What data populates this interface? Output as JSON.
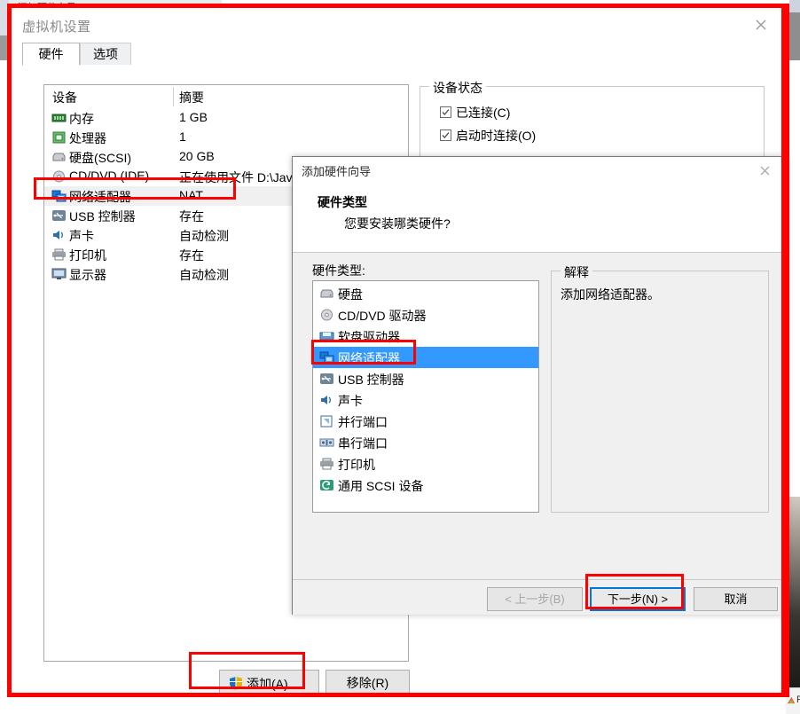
{
  "background": {
    "behind_window_title": "添加硬件向导",
    "taskbar_item": "Fa"
  },
  "vm_settings": {
    "title": "虚拟机设置",
    "close_icon": "close-icon",
    "tabs": [
      {
        "label": "硬件",
        "active": true
      },
      {
        "label": "选项",
        "active": false
      }
    ],
    "device_list": {
      "headers": {
        "device": "设备",
        "summary": "摘要"
      },
      "rows": [
        {
          "icon": "memory-icon",
          "name": "内存",
          "summary": "1 GB",
          "selected": false
        },
        {
          "icon": "cpu-icon",
          "name": "处理器",
          "summary": "1",
          "selected": false
        },
        {
          "icon": "harddisk-icon",
          "name": "硬盘(SCSI)",
          "summary": "20 GB",
          "selected": false
        },
        {
          "icon": "cddvd-icon",
          "name": "CD/DVD (IDE)",
          "summary": "正在使用文件 D:\\Jav",
          "selected": false
        },
        {
          "icon": "network-icon",
          "name": "网络适配器",
          "summary": "NAT",
          "selected": true
        },
        {
          "icon": "usb-icon",
          "name": "USB 控制器",
          "summary": "存在",
          "selected": false
        },
        {
          "icon": "sound-icon",
          "name": "声卡",
          "summary": "自动检测",
          "selected": false
        },
        {
          "icon": "printer-icon",
          "name": "打印机",
          "summary": "存在",
          "selected": false
        },
        {
          "icon": "display-icon",
          "name": "显示器",
          "summary": "自动检测",
          "selected": false
        }
      ]
    },
    "device_status": {
      "legend": "设备状态",
      "checkboxes": [
        {
          "label": "已连接(C)",
          "checked": true
        },
        {
          "label": "启动时连接(O)",
          "checked": true
        }
      ]
    },
    "buttons": {
      "add": "添加(A)...",
      "add_icon": "uac-shield-icon",
      "remove": "移除(R)"
    }
  },
  "wizard": {
    "title": "添加硬件向导",
    "close_icon": "close-icon",
    "heading": "硬件类型",
    "subheading": "您要安装哪类硬件?",
    "hardware_type_label": "硬件类型:",
    "hardware_types": [
      {
        "icon": "harddisk-icon",
        "name": "硬盘",
        "selected": false
      },
      {
        "icon": "cddvd-icon",
        "name": "CD/DVD 驱动器",
        "selected": false
      },
      {
        "icon": "floppy-icon",
        "name": "软盘驱动器",
        "selected": false
      },
      {
        "icon": "network-icon",
        "name": "网络适配器",
        "selected": true
      },
      {
        "icon": "usb-icon",
        "name": "USB 控制器",
        "selected": false
      },
      {
        "icon": "sound-icon",
        "name": "声卡",
        "selected": false
      },
      {
        "icon": "parallel-port-icon",
        "name": "并行端口",
        "selected": false
      },
      {
        "icon": "serial-port-icon",
        "name": "串行端口",
        "selected": false
      },
      {
        "icon": "printer-icon",
        "name": "打印机",
        "selected": false
      },
      {
        "icon": "scsi-icon",
        "name": "通用 SCSI 设备",
        "selected": false
      }
    ],
    "explanation": {
      "legend": "解释",
      "text": "添加网络适配器。"
    },
    "footer": {
      "back": "< 上一步(B)",
      "next": "下一步(N) >",
      "cancel": "取消"
    }
  },
  "annotations": {
    "accent_color": "#ff0000",
    "highlight_color": "#3399ff",
    "focus_color": "#0078d7"
  }
}
